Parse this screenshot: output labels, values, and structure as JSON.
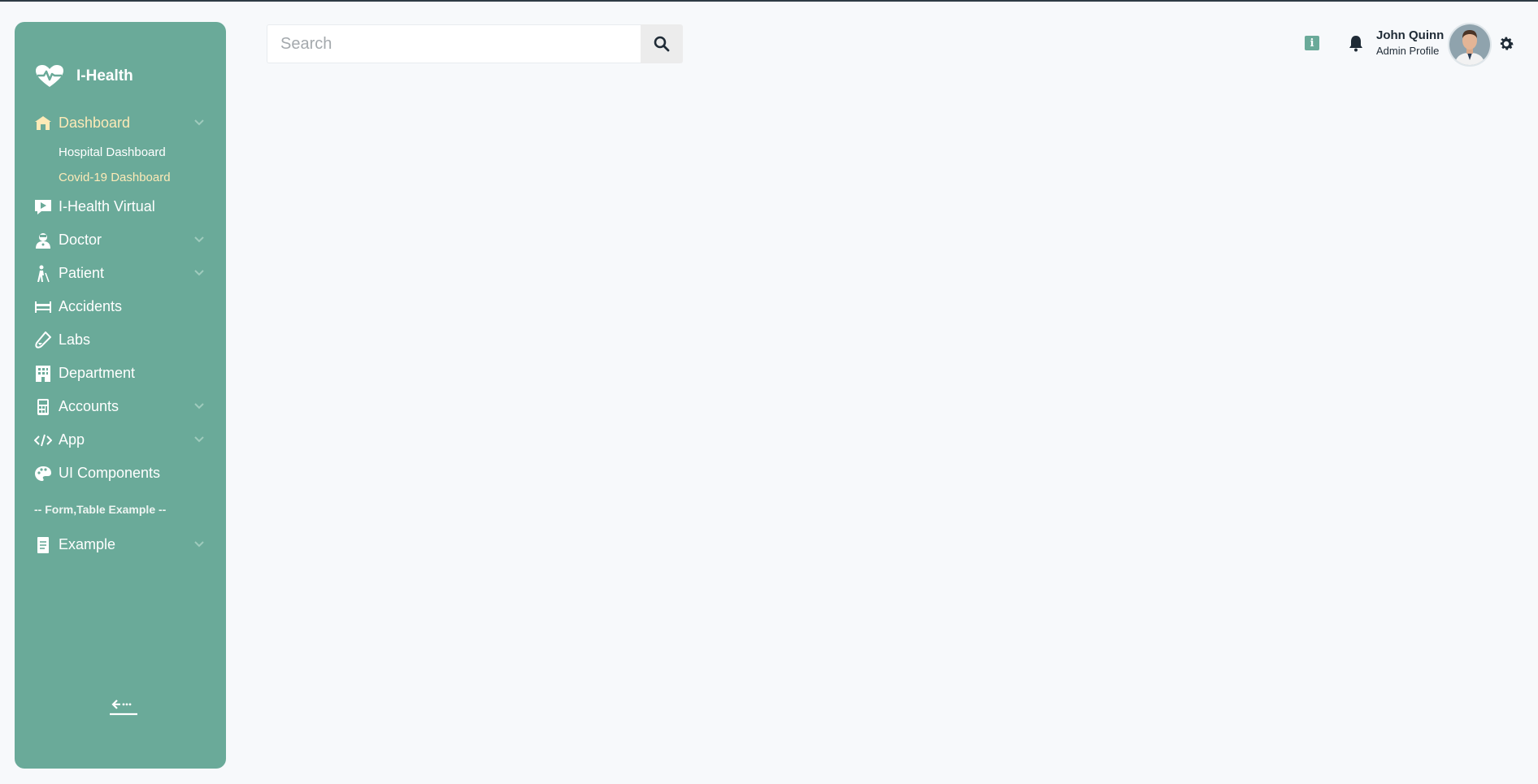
{
  "app": {
    "brand": "I-Health"
  },
  "search": {
    "placeholder": "Search"
  },
  "sidebar": {
    "items": [
      {
        "label": "Dashboard",
        "icon": "home-icon",
        "active": true,
        "has_children": true,
        "children": [
          {
            "label": "Hospital Dashboard",
            "active": false
          },
          {
            "label": "Covid-19 Dashboard",
            "active": true
          }
        ]
      },
      {
        "label": "I-Health Virtual",
        "icon": "video-chat-icon"
      },
      {
        "label": "Doctor",
        "icon": "doctor-icon",
        "has_children": true
      },
      {
        "label": "Patient",
        "icon": "patient-cane-icon",
        "has_children": true
      },
      {
        "label": "Accidents",
        "icon": "stretcher-icon"
      },
      {
        "label": "Labs",
        "icon": "test-tube-icon"
      },
      {
        "label": "Department",
        "icon": "building-icon"
      },
      {
        "label": "Accounts",
        "icon": "calculator-icon",
        "has_children": true
      },
      {
        "label": "App",
        "icon": "code-icon",
        "has_children": true
      },
      {
        "label": "UI Components",
        "icon": "palette-icon"
      }
    ],
    "section_title": "-- Form,Table Example --",
    "section_items": [
      {
        "label": "Example",
        "icon": "document-icon",
        "has_children": true
      }
    ]
  },
  "header": {
    "user_name": "John Quinn",
    "user_role": "Admin Profile",
    "info_glyph": "i"
  },
  "colors": {
    "sidebar_bg": "#6aaa99",
    "active_text": "#fdeab7",
    "page_bg": "#f7f9fb"
  }
}
